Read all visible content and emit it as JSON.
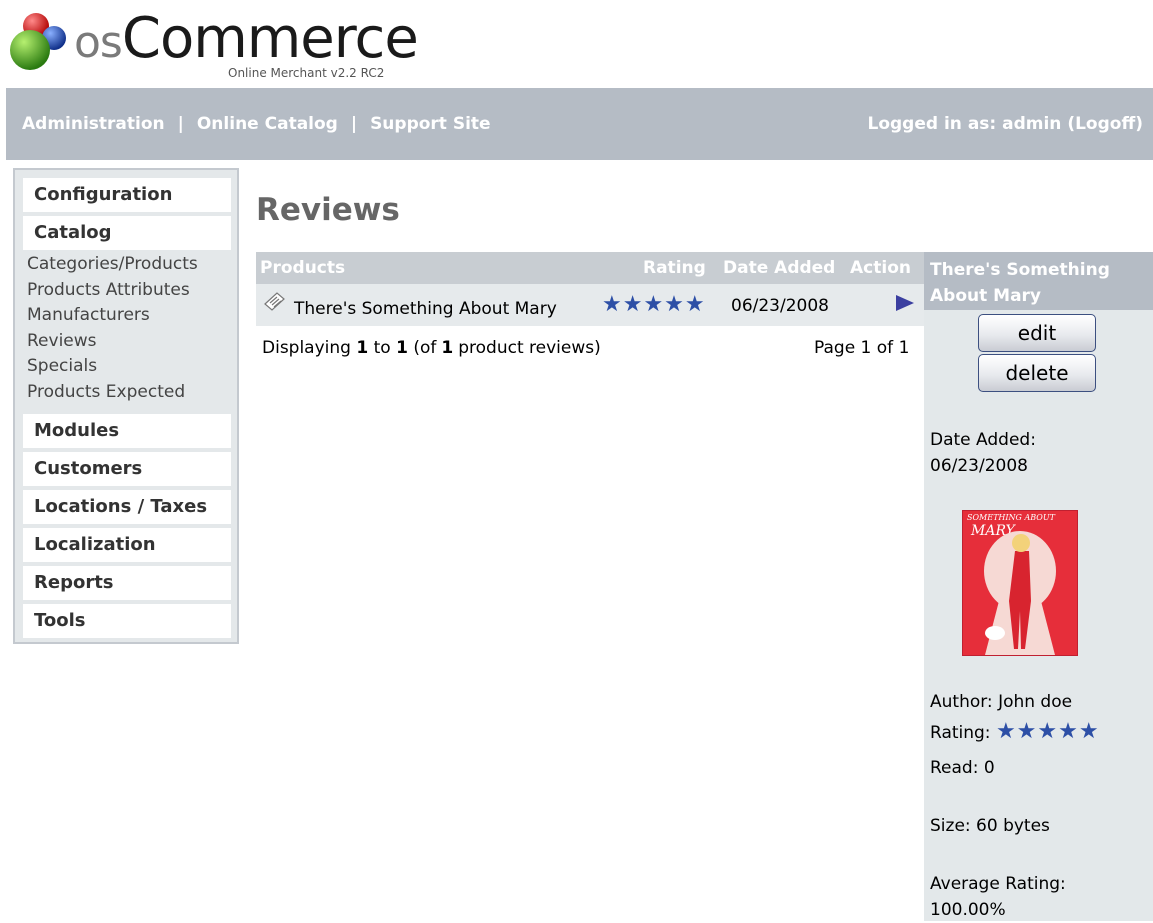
{
  "header": {
    "logo_os": "os",
    "logo_commerce": "Commerce",
    "subtitle": "Online Merchant v2.2 RC2"
  },
  "topnav": {
    "links": [
      "Administration",
      "Online Catalog",
      "Support Site"
    ],
    "separator": "|",
    "logged_in": "Logged in as: admin (Logoff)"
  },
  "sidebar": {
    "sections": [
      "Configuration",
      "Catalog",
      "Modules",
      "Customers",
      "Locations / Taxes",
      "Localization",
      "Reports",
      "Tools"
    ],
    "catalog_items": [
      "Categories/Products",
      "Products Attributes",
      "Manufacturers",
      "Reviews",
      "Specials",
      "Products Expected"
    ]
  },
  "main": {
    "title": "Reviews",
    "columns": {
      "products": "Products",
      "rating": "Rating",
      "date_added": "Date Added",
      "action": "Action"
    },
    "rows": [
      {
        "product": "There's Something About Mary",
        "rating_stars": "★★★★★",
        "rating_value": 5,
        "date": "06/23/2008"
      }
    ],
    "footer": {
      "displaying": "Displaying",
      "from": "1",
      "to_word": "to",
      "to": "1",
      "of_open": "(of",
      "total": "1",
      "of_close": "product reviews)",
      "page": "Page 1 of 1"
    }
  },
  "info": {
    "title": "There's Something About Mary",
    "edit_label": "edit",
    "delete_label": "delete",
    "date_label": "Date Added:",
    "date_value": "06/23/2008",
    "poster_text_top": "SOMETHING ABOUT",
    "poster_text_title": "MARY",
    "author": "Author: John doe",
    "rating_label": "Rating:",
    "rating_stars": "★★★★★",
    "read": "Read: 0",
    "size": "Size: 60 bytes",
    "avg_label": "Average Rating:",
    "avg_value": "100.00%"
  }
}
